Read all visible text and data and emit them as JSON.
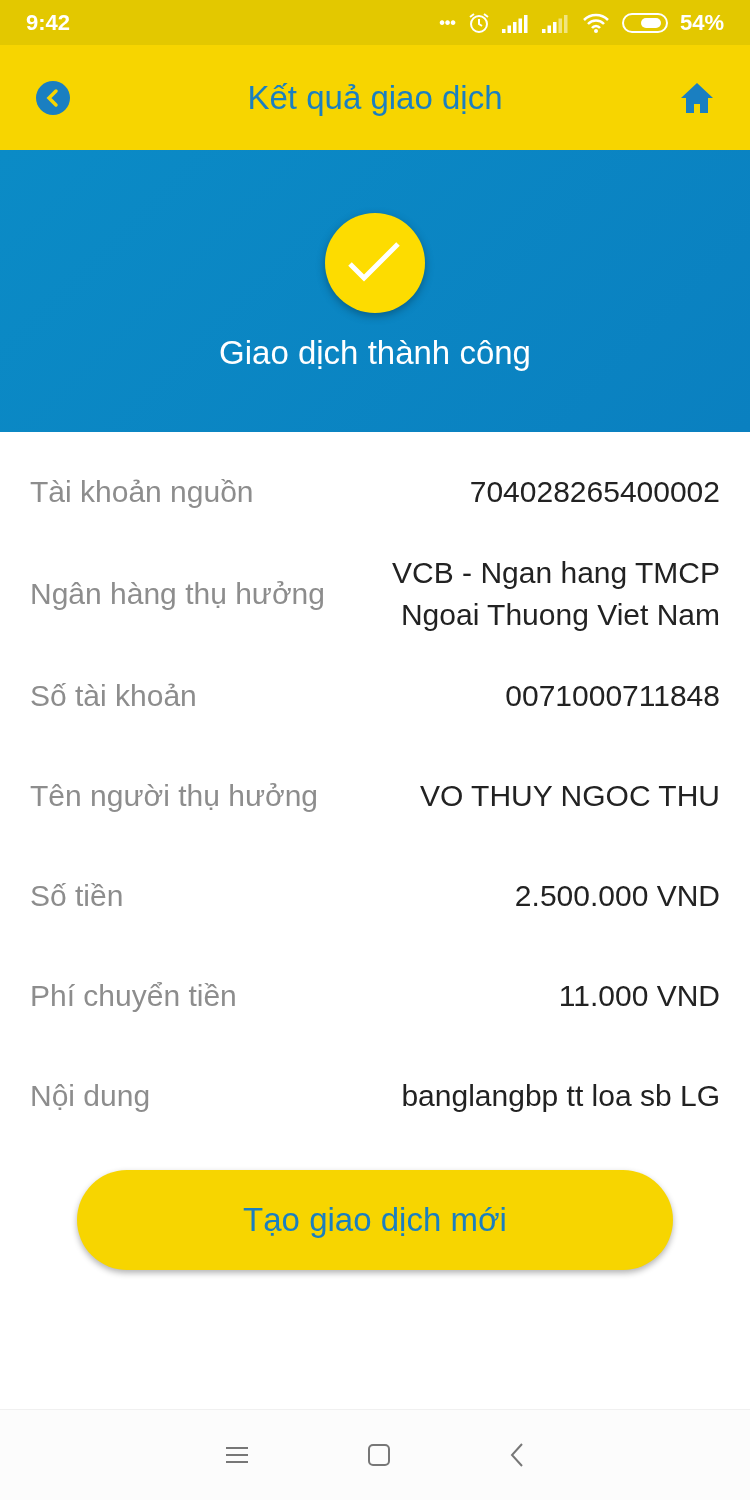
{
  "status_bar": {
    "time": "9:42",
    "more": "•••",
    "battery": "54%"
  },
  "header": {
    "title": "Kết quả giao dịch"
  },
  "banner": {
    "message": "Giao dịch thành công"
  },
  "details": [
    {
      "label": "Tài khoản nguồn",
      "value": "704028265400002"
    },
    {
      "label": "Ngân hàng thụ hưởng",
      "value": "VCB - Ngan hang TMCP Ngoai Thuong Viet Nam"
    },
    {
      "label": "Số tài khoản",
      "value": "0071000711848"
    },
    {
      "label": "Tên người thụ hưởng",
      "value": "VO THUY NGOC THU"
    },
    {
      "label": "Số tiền",
      "value": "2.500.000 VND"
    },
    {
      "label": "Phí chuyển tiền",
      "value": "11.000 VND"
    },
    {
      "label": "Nội dung",
      "value": "banglangbp tt loa sb LG"
    }
  ],
  "action_button": "Tạo giao dịch mới"
}
